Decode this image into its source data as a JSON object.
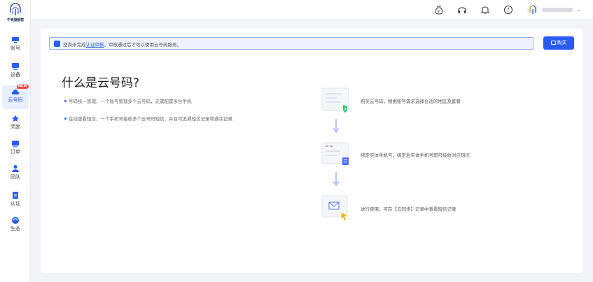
{
  "brand": {
    "name": "牛卖旗舰营"
  },
  "sidebar": {
    "items": [
      {
        "label": "账号",
        "icon": "account-icon"
      },
      {
        "label": "设备",
        "icon": "device-icon"
      },
      {
        "label": "云号码",
        "icon": "cloud-number-icon",
        "badge": "NEW",
        "active": true
      },
      {
        "label": "奖励",
        "icon": "reward-icon"
      },
      {
        "label": "订单",
        "icon": "order-icon"
      },
      {
        "label": "团队",
        "icon": "team-icon"
      },
      {
        "label": "认证",
        "icon": "verify-icon"
      },
      {
        "label": "生态",
        "icon": "ecosystem-icon"
      }
    ]
  },
  "topbar": {
    "icons": [
      "money-bag-icon",
      "headset-icon",
      "bell-icon",
      "help-icon"
    ]
  },
  "notice": {
    "prefix": "您尚未完成",
    "link": "认证审核",
    "suffix": "，审核通过后才可以使用云号码服务。"
  },
  "buy_button": {
    "label": "购买"
  },
  "main": {
    "title": "什么是云号码?",
    "bullets": [
      "号码统一管理，一个账号管理多个云号码，无需配置多台手机",
      "在线查看短信，一个手机号接收多个云号码短信，并且可追溯短信记录和通话记录"
    ]
  },
  "steps": [
    {
      "text": "购买云号码，根据账号需求选择合适的地区及套餐"
    },
    {
      "text": "绑定实体手机号，绑定后实体手机号即可接收对应短信"
    },
    {
      "text": "进行使用，可在【云同步】记录中查看短信记录"
    }
  ],
  "colors": {
    "accent": "#2a5bf5",
    "badge": "#ff4b4b"
  }
}
